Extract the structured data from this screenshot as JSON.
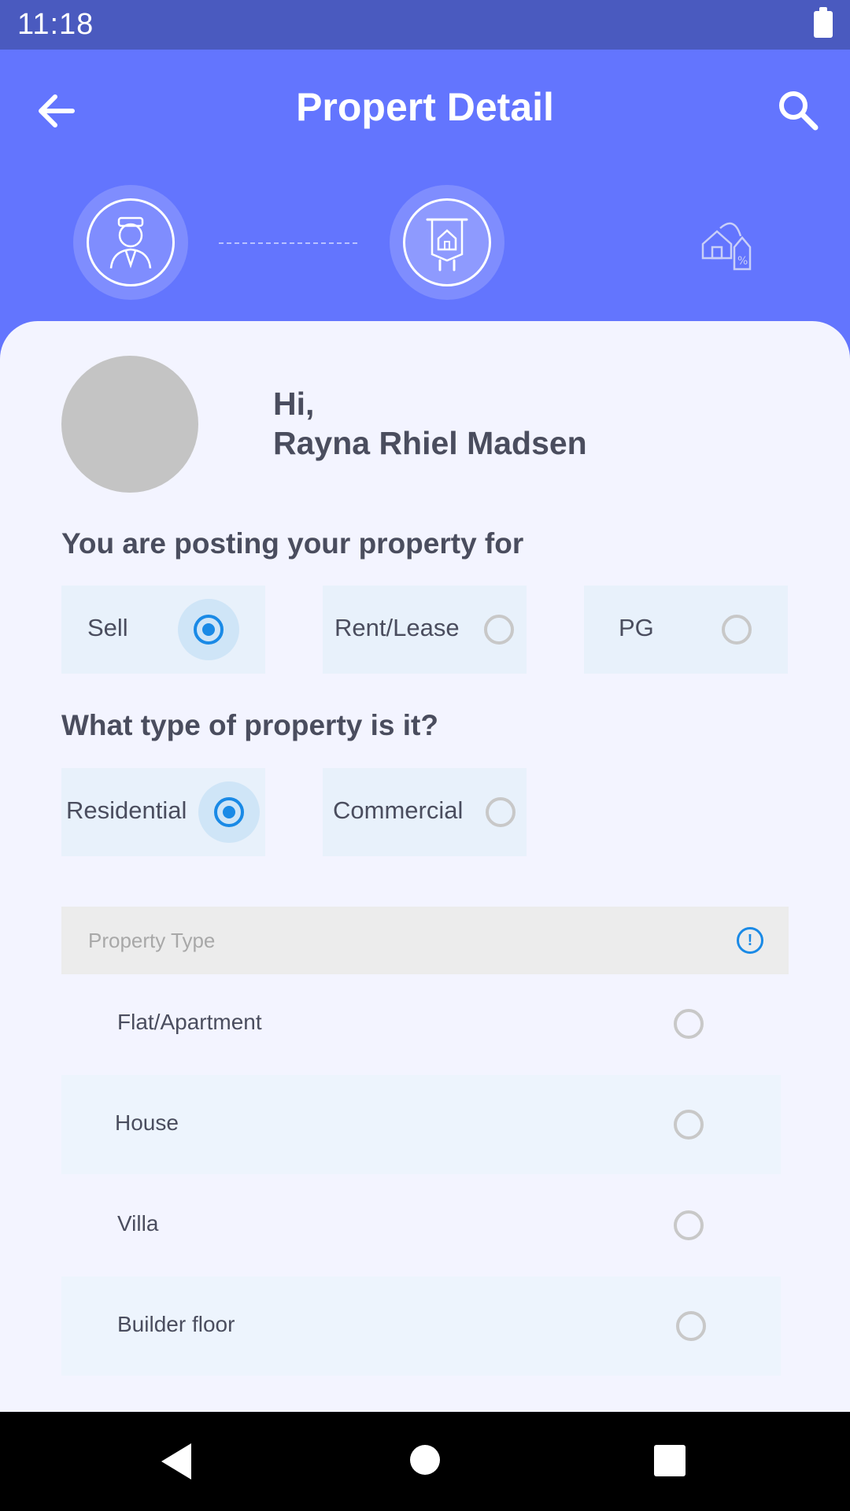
{
  "status_bar": {
    "time": "11:18",
    "battery_icon": "battery-full-icon"
  },
  "app_bar": {
    "title": "Propert Detail",
    "back_icon": "arrow-back-icon",
    "search_icon": "search-icon"
  },
  "stepper": {
    "steps": [
      {
        "icon": "person-icon",
        "state": "done"
      },
      {
        "icon": "property-signboard-icon",
        "state": "active"
      },
      {
        "icon": "house-price-tag-icon",
        "state": "pending"
      }
    ]
  },
  "profile": {
    "greeting": "Hi,",
    "name": "Rayna Rhiel Madsen"
  },
  "posting_for": {
    "label": "You are posting your property for",
    "options": [
      {
        "label": "Sell",
        "selected": true
      },
      {
        "label": "Rent/Lease",
        "selected": false
      },
      {
        "label": "PG",
        "selected": false
      }
    ]
  },
  "property_category": {
    "label": "What type of property is it?",
    "options": [
      {
        "label": "Residential",
        "selected": true
      },
      {
        "label": "Commercial",
        "selected": false
      }
    ]
  },
  "property_type": {
    "placeholder": "Property Type",
    "info_icon": "info-icon",
    "options": [
      {
        "label": "Flat/Apartment",
        "selected": false
      },
      {
        "label": "House",
        "selected": false
      },
      {
        "label": "Villa",
        "selected": false
      },
      {
        "label": "Builder floor",
        "selected": false
      }
    ]
  },
  "nav_bar": {
    "back_icon": "nav-back-icon",
    "home_icon": "nav-home-icon",
    "recents_icon": "nav-recents-icon"
  },
  "colors": {
    "primary": "#6375fe",
    "status_bar": "#4a5abf",
    "accent": "#1a8ae6",
    "card_bg": "#f3f4ff",
    "chip_bg": "#e8f1fb",
    "text": "#4a4d5e"
  }
}
